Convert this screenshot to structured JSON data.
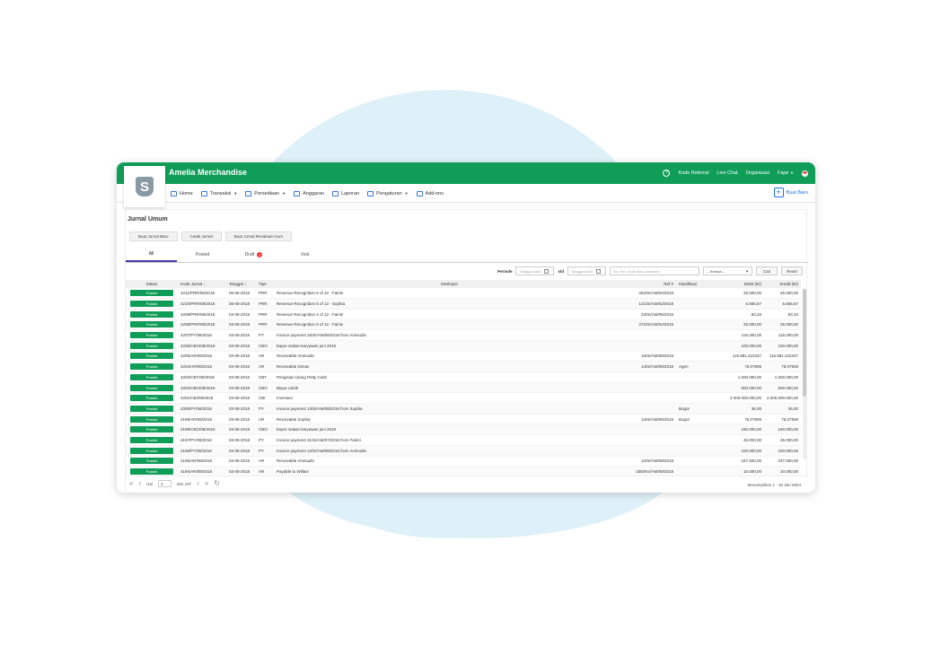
{
  "app": {
    "company": "Amelia Merchandise",
    "logo_letter": "S",
    "top_links": [
      "Kode Referral",
      "Live Chat",
      "Organisasi",
      "Fajar"
    ],
    "brand_color": "#0f9d58"
  },
  "nav": {
    "items": [
      {
        "label": "Home",
        "icon": "speedometer-icon",
        "dropdown": false
      },
      {
        "label": "Transaksi",
        "icon": "money-icon",
        "dropdown": true
      },
      {
        "label": "Persediaan",
        "icon": "box-icon",
        "dropdown": true
      },
      {
        "label": "Anggaran",
        "icon": "document-icon",
        "dropdown": false
      },
      {
        "label": "Laporan",
        "icon": "report-icon",
        "dropdown": false
      },
      {
        "label": "Pengaturan",
        "icon": "gear-icon",
        "dropdown": true
      },
      {
        "label": "Add-ons",
        "icon": "tag-icon",
        "dropdown": false
      }
    ],
    "create_label": "Buat Baru"
  },
  "page": {
    "title": "Jurnal Umum",
    "buttons": [
      "Buat Jurnal Baru",
      "Cetak Jurnal",
      "Buat Jurnal Revaluasi Kurs"
    ],
    "tabs": [
      {
        "label": "All",
        "active": true,
        "badge": ""
      },
      {
        "label": "Posted",
        "active": false,
        "badge": ""
      },
      {
        "label": "Draft",
        "active": false,
        "badge": "1"
      },
      {
        "label": "Void",
        "active": false,
        "badge": ""
      }
    ]
  },
  "filters": {
    "period_label": "Periode",
    "start_placeholder": "Tanggal Awal",
    "sd_label": "s/d",
    "end_placeholder": "Tanggal Akhir",
    "search_placeholder": "No. Ref, Kode atau Deskripsi",
    "select_value": "-- Semua --",
    "search_button": "Cari",
    "reset_button": "Reset"
  },
  "table": {
    "headers": [
      "Status",
      "Kode Jurnal",
      "Tanggal",
      "Tipe",
      "Deskripsi",
      "Ref #",
      "Klasifikasi",
      "Debit (ID)",
      "Kredit (ID)"
    ],
    "rows": [
      {
        "status": "Posted",
        "kode": "4211/PRR/08/2018",
        "tanggal": "06-08-2018",
        "tipe": "PRR",
        "deskripsi": "Revenue Recognition 5 of 12 - Fairini",
        "ref": "284/SI/AM/04/2018",
        "klasifikasi": "",
        "debit": "25.000,00",
        "kredit": "25.000,00"
      },
      {
        "status": "Posted",
        "kode": "4210/PRR/08/2018",
        "tanggal": "05-08-2018",
        "tipe": "PRR",
        "deskripsi": "Revenue Recognition 6 of 12 - Sophia",
        "ref": "121/SI/AM/02/2018",
        "klasifikasi": "",
        "debit": "6.666,67",
        "kredit": "6.666,67"
      },
      {
        "status": "Posted",
        "kode": "4209/PRR/08/2018",
        "tanggal": "04-08-2018",
        "tipe": "PRR",
        "deskripsi": "Revenue Recognition 4 of 12 - Fairini",
        "ref": "23/SI/AM/05/2018",
        "klasifikasi": "",
        "debit": "83,33",
        "kredit": "83,33"
      },
      {
        "status": "Posted",
        "kode": "4208/PRR/08/2018",
        "tanggal": "03-08-2018",
        "tipe": "PRR",
        "deskripsi": "Revenue Recognition 5 of 12 - Fairini",
        "ref": "272/SI/AM/04/2018",
        "klasifikasi": "",
        "debit": "25.000,00",
        "kredit": "25.000,00"
      },
      {
        "status": "Posted",
        "kode": "4207/PY/08/2018",
        "tanggal": "03-08-2018",
        "tipe": "PY",
        "deskripsi": "Invoice payment 15/SI/AM/08/2018 from Aminudin",
        "ref": "",
        "klasifikasi": "",
        "debit": "115.000,00",
        "kredit": "115.000,00"
      },
      {
        "status": "Posted",
        "kode": "4206/CBO/08/2018",
        "tanggal": "03-08-2018",
        "tipe": "CBO",
        "deskripsi": "bayar makan karyawan juni 2018",
        "ref": "",
        "klasifikasi": "",
        "debit": "100.000,00",
        "kredit": "100.000,00"
      },
      {
        "status": "Posted",
        "kode": "4205/AR/08/2018",
        "tanggal": "03-08-2018",
        "tipe": "AR",
        "deskripsi": "Receivable Aminudin",
        "ref": "15/SI/AM/08/2018",
        "klasifikasi": "",
        "debit": "115.981,422337",
        "kredit": "115.981,422337"
      },
      {
        "status": "Posted",
        "kode": "4204/AR/08/2018",
        "tanggal": "03-08-2018",
        "tipe": "AR",
        "deskripsi": "Receivable Dimas",
        "ref": "14/SI/AM/08/2018",
        "klasifikasi": "Agen",
        "debit": "76,07909",
        "kredit": "76,07909"
      },
      {
        "status": "Posted",
        "kode": "4203/CBT/08/2018",
        "tanggal": "03-08-2018",
        "tipe": "CBT",
        "deskripsi": "Pengisian Ulang Petty Cash",
        "ref": "",
        "klasifikasi": "",
        "debit": "1.000.000,00",
        "kredit": "1.000.000,00"
      },
      {
        "status": "Posted",
        "kode": "4202/CBO/08/2018",
        "tanggal": "03-08-2018",
        "tipe": "CBO",
        "deskripsi": "Biaya Listrik",
        "ref": "",
        "klasifikasi": "",
        "debit": "500.000,00",
        "kredit": "500.000,00"
      },
      {
        "status": "Posted",
        "kode": "4201/CBI/08/2018",
        "tanggal": "03-08-2018",
        "tipe": "CBI",
        "deskripsi": "Investasi",
        "ref": "",
        "klasifikasi": "",
        "debit": "2.000.000.000,00",
        "kredit": "2.000.000.000,00"
      },
      {
        "status": "Posted",
        "kode": "4200/PY/08/2018",
        "tanggal": "03-08-2018",
        "tipe": "PY",
        "deskripsi": "Invoice payment 13/SI/AM/08/2018 from Sophia",
        "ref": "",
        "klasifikasi": "Bogor",
        "debit": "36,00",
        "kredit": "36,00"
      },
      {
        "status": "Posted",
        "kode": "4199/AR/08/2018",
        "tanggal": "03-08-2018",
        "tipe": "AR",
        "deskripsi": "Receivable Sophia",
        "ref": "13/SI/AM/08/2018",
        "klasifikasi": "Bogor",
        "debit": "76,07909",
        "kredit": "76,07909"
      },
      {
        "status": "Posted",
        "kode": "4198/CBO/08/2018",
        "tanggal": "03-08-2018",
        "tipe": "CBO",
        "deskripsi": "bayar makan karyawan juni 2018",
        "ref": "",
        "klasifikasi": "",
        "debit": "150.000,00",
        "kredit": "150.000,00"
      },
      {
        "status": "Posted",
        "kode": "4197/PY/08/2018",
        "tanggal": "03-08-2018",
        "tipe": "PY",
        "deskripsi": "Invoice payment 31/SI/AM/07/2018 from Fairini",
        "ref": "",
        "klasifikasi": "",
        "debit": "45.000,00",
        "kredit": "45.000,00"
      },
      {
        "status": "Posted",
        "kode": "4196/PY/08/2018",
        "tanggal": "03-08-2018",
        "tipe": "PY",
        "deskripsi": "Invoice payment 12/SI/AM/08/2018 from Aminudin",
        "ref": "",
        "klasifikasi": "",
        "debit": "100.000,00",
        "kredit": "100.000,00"
      },
      {
        "status": "Posted",
        "kode": "4195/AR/08/2018",
        "tanggal": "03-08-2018",
        "tipe": "AR",
        "deskripsi": "Receivable Aminudin",
        "ref": "12/SI/AM/08/2018",
        "klasifikasi": "",
        "debit": "247.500,00",
        "kredit": "247.500,00"
      },
      {
        "status": "Posted",
        "kode": "4194/AR/08/2018",
        "tanggal": "03-08-2018",
        "tipe": "AR",
        "deskripsi": "Payable to Willam",
        "ref": "335/INV/AM/08/2018",
        "klasifikasi": "",
        "debit": "10.000,00",
        "kredit": "10.000,00"
      }
    ]
  },
  "pager": {
    "hal_label": "Hal",
    "page": "1",
    "of_label": "dari 197",
    "summary": "Menampilkan 1 - 30 dari 5904"
  }
}
